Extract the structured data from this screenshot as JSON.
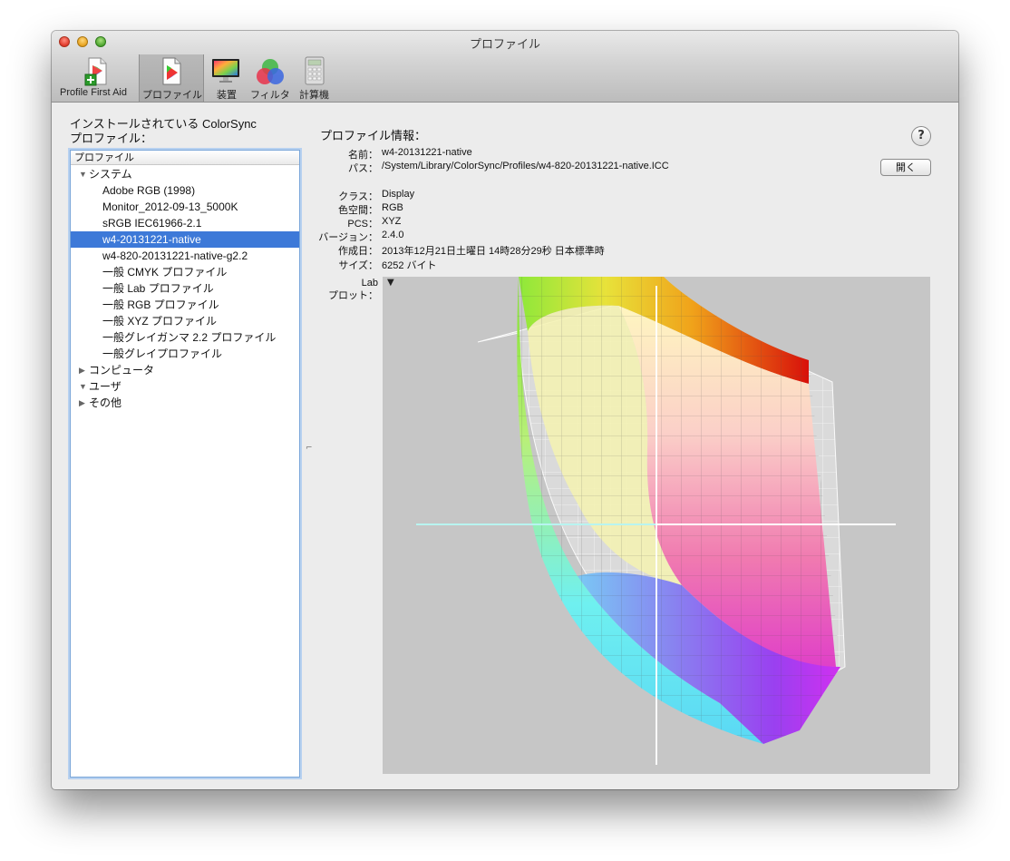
{
  "window": {
    "title": "プロファイル"
  },
  "toolbar": {
    "items": [
      {
        "label": "Profile First Aid",
        "icon": "first-aid-doc-icon"
      },
      {
        "label": "プロファイル",
        "icon": "profile-doc-icon",
        "selected": true
      },
      {
        "label": "装置",
        "icon": "display-icon"
      },
      {
        "label": "フィルタ",
        "icon": "color-filter-icon"
      },
      {
        "label": "計算機",
        "icon": "calculator-icon"
      }
    ]
  },
  "left_pane": {
    "title_line1": "インストールされている ColorSync",
    "title_line2": "プロファイル：",
    "column_header": "プロファイル",
    "groups": [
      {
        "label": "システム",
        "expanded": true
      },
      {
        "label": "コンピュータ",
        "expanded": false
      },
      {
        "label": "ユーザ",
        "expanded": true
      },
      {
        "label": "その他",
        "expanded": false
      }
    ],
    "system_items": [
      "Adobe RGB (1998)",
      "Monitor_2012-09-13_5000K",
      "sRGB IEC61966-2.1",
      "w4-20131221-native",
      "w4-820-20131221-native-g2.2",
      "一般 CMYK プロファイル",
      "一般 Lab プロファイル",
      "一般 RGB プロファイル",
      "一般 XYZ プロファイル",
      "一般グレイガンマ 2.2 プロファイル",
      "一般グレイプロファイル"
    ],
    "selected_item": "w4-20131221-native"
  },
  "info": {
    "heading": "プロファイル情報：",
    "name_label": "名前：",
    "name_value": "w4-20131221-native",
    "path_label": "パス：",
    "path_value": "/System/Library/ColorSync/Profiles/w4-820-20131221-native.ICC",
    "open_button": "開く",
    "class_label": "クラス：",
    "class_value": "Display",
    "space_label": "色空間：",
    "space_value": "RGB",
    "pcs_label": "PCS：",
    "pcs_value": "XYZ",
    "version_label": "バージョン：",
    "version_value": "2.4.0",
    "created_label": "作成日：",
    "created_value": "2013年12月21日土曜日 14時28分29秒 日本標準時",
    "size_label": "サイズ：",
    "size_value": "6252 バイト",
    "plot_label_line1": "Lab",
    "plot_label_line2": "プロット：",
    "help": "?"
  },
  "colors": {
    "selection": "#3d79d8",
    "plot_bg": "#c6c6c6"
  }
}
